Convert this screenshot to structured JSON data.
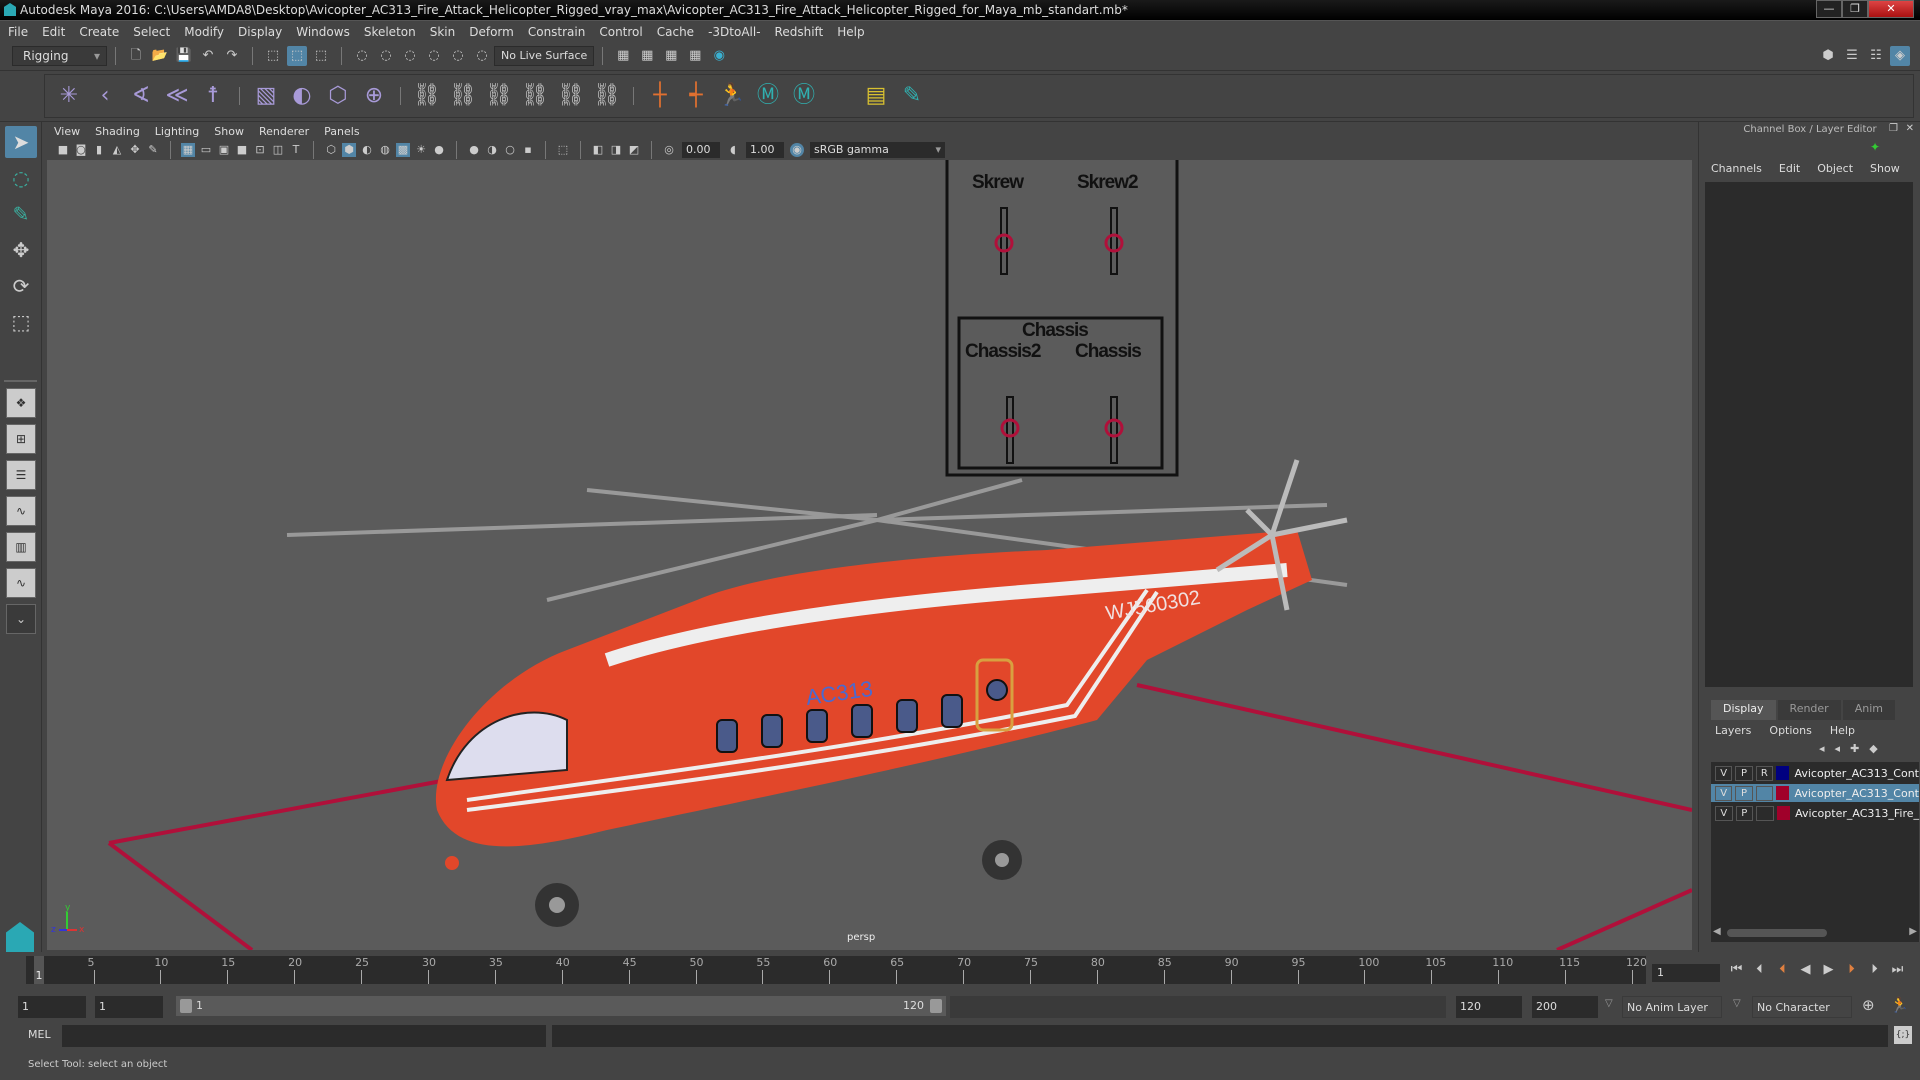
{
  "window": {
    "title": "Autodesk Maya 2016: C:\\Users\\AMDA8\\Desktop\\Avicopter_AC313_Fire_Attack_Helicopter_Rigged_vray_max\\Avicopter_AC313_Fire_Attack_Helicopter_Rigged_for_Maya_mb_standart.mb*",
    "minimize": "—",
    "maximize": "❐",
    "close": "✕"
  },
  "menubar": [
    "File",
    "Edit",
    "Create",
    "Select",
    "Modify",
    "Display",
    "Windows",
    "Skeleton",
    "Skin",
    "Deform",
    "Constrain",
    "Control",
    "Cache",
    "-3DtoAll-",
    "Redshift",
    "Help"
  ],
  "statusline": {
    "mode": "Rigging",
    "live_surface": "No Live Surface"
  },
  "viewport": {
    "menu": [
      "View",
      "Shading",
      "Lighting",
      "Show",
      "Renderer",
      "Panels"
    ],
    "near_clip": "0.00",
    "exposure": "1.00",
    "color_space": "sRGB gamma",
    "camera_label": "persp",
    "scene": {
      "controls": [
        {
          "label": "Skrew"
        },
        {
          "label": "Skrew2"
        },
        {
          "label": "Chassis2"
        },
        {
          "label": "Chassis"
        }
      ],
      "group_label": "Chassis",
      "helicopter_model": "AC313",
      "helicopter_reg": "WJ560302"
    },
    "axis": {
      "x": "x",
      "y": "y",
      "z": "z"
    }
  },
  "channel_box": {
    "title": "Channel Box / Layer Editor",
    "menu": [
      "Channels",
      "Edit",
      "Object",
      "Show"
    ]
  },
  "layer_editor": {
    "tabs": [
      "Display",
      "Render",
      "Anim"
    ],
    "active_tab": "Display",
    "menu": [
      "Layers",
      "Options",
      "Help"
    ],
    "layers": [
      {
        "v": "V",
        "p": "P",
        "r": "R",
        "color": "#000080",
        "name": "Avicopter_AC313_Cont",
        "selected": false
      },
      {
        "v": "V",
        "p": "P",
        "r": "",
        "color": "#a0002a",
        "name": "Avicopter_AC313_Cont",
        "selected": true
      },
      {
        "v": "V",
        "p": "P",
        "r": "",
        "color": "#a0002a",
        "name": "Avicopter_AC313_Fire_",
        "selected": false
      }
    ]
  },
  "timeline": {
    "ticks": [
      1,
      5,
      10,
      15,
      20,
      25,
      30,
      35,
      40,
      45,
      50,
      55,
      60,
      65,
      70,
      75,
      80,
      85,
      90,
      95,
      100,
      105,
      110,
      115,
      120
    ],
    "current_frame_marker": "1",
    "current_frame": "1"
  },
  "range": {
    "start_time": "1",
    "playback_start": "1",
    "range_start_label": "1",
    "range_end_label": "120",
    "playback_end": "120",
    "end_time": "200",
    "anim_layer": "No Anim Layer",
    "character_set": "No Character Set"
  },
  "command_line": {
    "label": "MEL"
  },
  "help_line": "Select Tool: select an object",
  "colors": {
    "accent": "#5285a6",
    "control_red": "#b0103a",
    "helicopter": "#e2472a"
  }
}
